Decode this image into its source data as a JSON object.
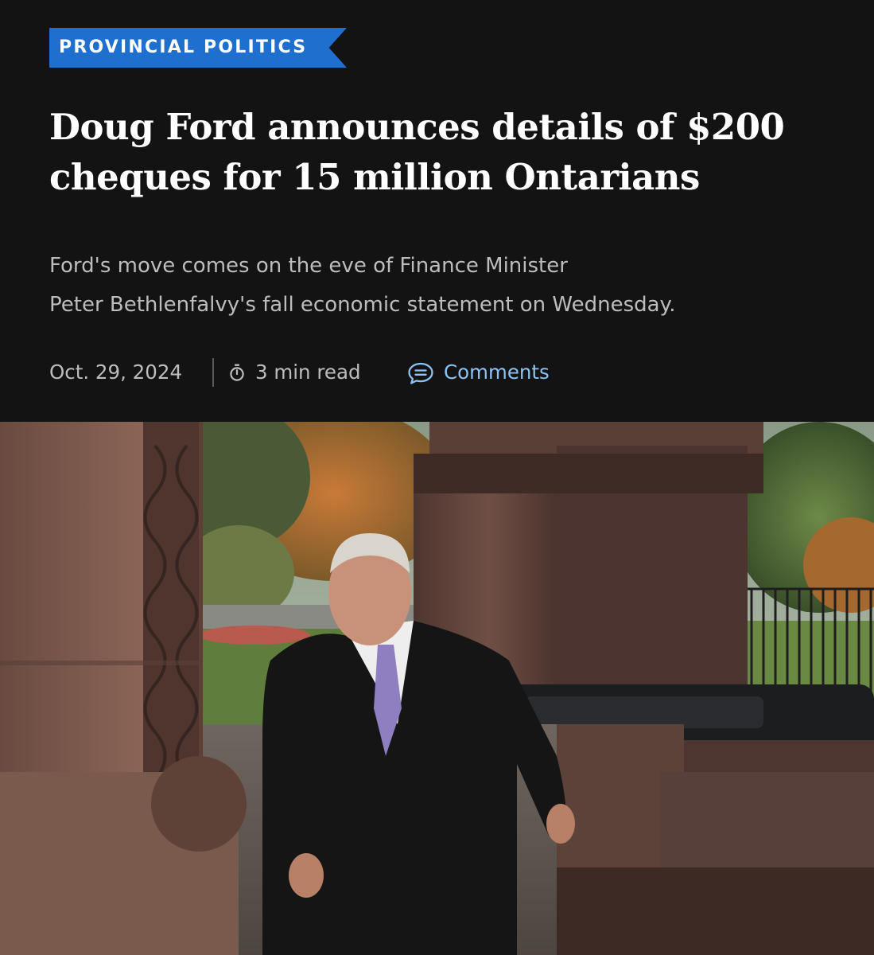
{
  "article": {
    "category": "PROVINCIAL POLITICS",
    "headline_line1": "Doug Ford announces details of $200",
    "headline_line2": "cheques for 15 million Ontarians",
    "subhead_line1": "Ford's move comes on the eve of Finance Minister",
    "subhead_line2": "Peter Bethlenfalvy's fall economic statement on Wednesday.",
    "date": "Oct. 29, 2024",
    "read_time": "3 min read",
    "comments_label": "Comments"
  },
  "icons": {
    "timer": "stopwatch-icon",
    "comments": "speech-bubble-icon"
  },
  "colors": {
    "background": "#131313",
    "tag_blue": "#1f6fcf",
    "link_blue": "#8dc3f2",
    "meta_gray": "#bdbdbd"
  }
}
